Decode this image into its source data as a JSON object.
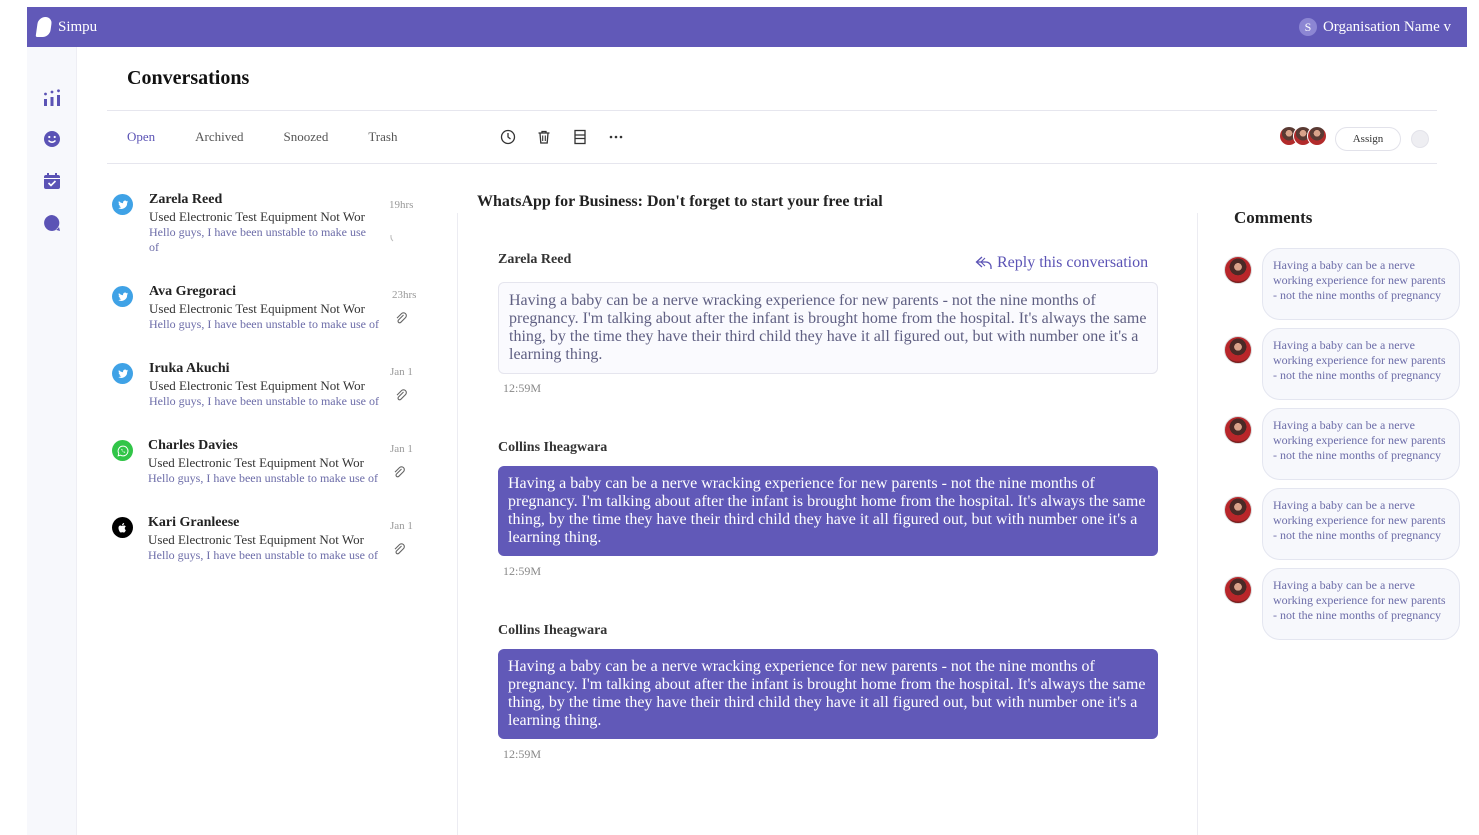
{
  "app": {
    "brand": "Simpu",
    "org_name": "Organisation Name v",
    "org_initial": "S"
  },
  "nav": {
    "items": [
      "analytics-icon",
      "smiley-icon",
      "calendar-icon",
      "chat-icon"
    ]
  },
  "page": {
    "title": "Conversations"
  },
  "tabs": [
    {
      "label": "Open",
      "active": true
    },
    {
      "label": "Archived"
    },
    {
      "label": "Snoozed"
    },
    {
      "label": "Trash"
    }
  ],
  "toolbar": {
    "assign_label": "Assign"
  },
  "conversations": [
    {
      "name": "Zarela Reed",
      "channel": "twitter",
      "subject": "Used Electronic Test Equipment Not Wor",
      "preview": "Hello guys, I have been unstable to make use of",
      "time": "19hrs"
    },
    {
      "name": "Ava Gregoraci",
      "channel": "twitter",
      "subject": "Used Electronic Test Equipment Not Wor",
      "preview": "Hello guys, I have been unstable to make use of",
      "time": "23hrs"
    },
    {
      "name": "Iruka Akuchi",
      "channel": "twitter",
      "subject": "Used Electronic Test Equipment Not Wor",
      "preview": "Hello guys, I have been unstable to make use of",
      "time": "Jan 1"
    },
    {
      "name": "Charles Davies",
      "channel": "whatsapp",
      "subject": "Used Electronic Test Equipment Not Wor",
      "preview": "Hello guys, I have been unstable to make use of",
      "time": "Jan 1"
    },
    {
      "name": "Kari Granleese",
      "channel": "apple",
      "subject": "Used Electronic Test Equipment Not Wor",
      "preview": "Hello guys, I have been unstable to make use of",
      "time": "Jan 1"
    }
  ],
  "thread": {
    "title": "WhatsApp for Business: Don't forget to start your free trial",
    "reply_label": "Reply this conversation",
    "messages": [
      {
        "author": "Zarela Reed",
        "text": "Having a baby can be a nerve wracking experience for new parents - not the nine months of pregnancy. I'm talking about after the infant is brought home from the hospital. It's always the same thing, by the time they have their third child they have it all figured out, but with number one it's a learning thing.",
        "time": "12:59M",
        "direction": "in"
      },
      {
        "author": "Collins Iheagwara",
        "text": "Having a baby can be a nerve wracking experience for new parents - not the nine months of pregnancy. I'm talking about after the infant is brought home from the hospital. It's always the same thing, by the time they have their third child they have it all figured out, but with number one it's a learning thing.",
        "time": "12:59M",
        "direction": "out"
      },
      {
        "author": "Collins Iheagwara",
        "text": "Having a baby can be a nerve wracking experience for new parents - not the nine months of pregnancy. I'm talking about after the infant is brought home from the hospital. It's always the same thing, by the time they have their third child they have it all figured out, but with number one it's a learning thing.",
        "time": "12:59M",
        "direction": "out"
      }
    ]
  },
  "comments": {
    "title": "Comments",
    "items": [
      {
        "text": "Having a baby can be a nerve working experience for new parents - not the nine months of pregnancy"
      },
      {
        "text": "Having a baby can be a nerve working experience for new parents - not the nine months of pregnancy"
      },
      {
        "text": "Having a baby can be a nerve working experience for new parents - not the nine months of pregnancy"
      },
      {
        "text": "Having a baby can be a nerve working experience for new parents - not the nine months of pregnancy"
      },
      {
        "text": "Having a baby can be a nerve working experience for new parents - not the nine months of pregnancy"
      }
    ]
  },
  "colors": {
    "accent": "#6159b8",
    "twitter": "#3fa2e6",
    "whatsapp": "#31c548"
  }
}
